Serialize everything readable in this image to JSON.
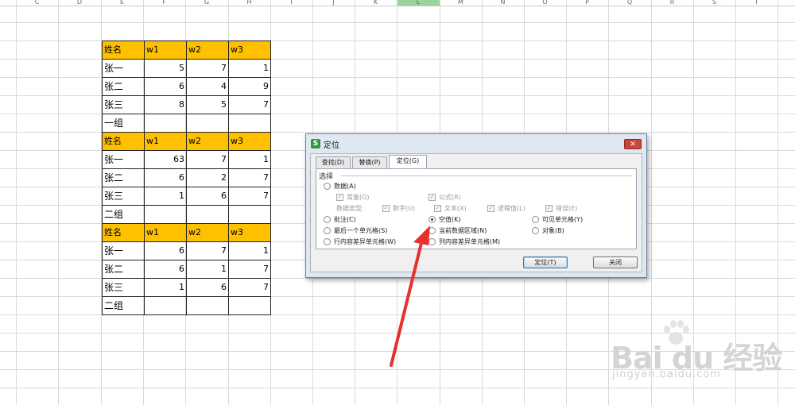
{
  "column_headers": [
    "C",
    "D",
    "E",
    "F",
    "G",
    "H",
    "I",
    "J",
    "K",
    "L",
    "M",
    "N",
    "O",
    "P",
    "Q",
    "R",
    "S",
    "T"
  ],
  "active_column": "L",
  "tables": [
    {
      "header": [
        "姓名",
        "w1",
        "w2",
        "w3"
      ],
      "rows": [
        [
          "张一",
          "5",
          "7",
          "1"
        ],
        [
          "张二",
          "6",
          "4",
          "9"
        ],
        [
          "张三",
          "8",
          "5",
          "7"
        ],
        [
          "一组",
          "",
          "",
          ""
        ]
      ]
    },
    {
      "header": [
        "姓名",
        "w1",
        "w2",
        "w3"
      ],
      "rows": [
        [
          "张一",
          "63",
          "7",
          "1"
        ],
        [
          "张二",
          "6",
          "2",
          "7"
        ],
        [
          "张三",
          "1",
          "6",
          "7"
        ],
        [
          "二组",
          "",
          "",
          ""
        ]
      ]
    },
    {
      "header": [
        "姓名",
        "w1",
        "w2",
        "w3"
      ],
      "rows": [
        [
          "张一",
          "6",
          "7",
          "1"
        ],
        [
          "张二",
          "6",
          "1",
          "7"
        ],
        [
          "张三",
          "1",
          "6",
          "7"
        ],
        [
          "二组",
          "",
          "",
          ""
        ]
      ]
    }
  ],
  "dialog": {
    "logo": "S",
    "title": "定位",
    "close": "✕",
    "tabs": [
      "查找(D)",
      "替换(P)",
      "定位(G)"
    ],
    "active_tab": "定位(G)",
    "group_label": "选择",
    "options": {
      "data": "数据(A)",
      "constant": "常量(O)",
      "formula": "公式(R)",
      "data_type": "数据类型:",
      "number": "数字(U)",
      "text": "文本(X)",
      "logical": "逻辑值(L)",
      "error": "错误(E)",
      "comment": "批注(C)",
      "blank": "空值(K)",
      "visible": "可见单元格(Y)",
      "last_cell": "最后一个单元格(S)",
      "current_region": "当前数据区域(N)",
      "object": "对象(B)",
      "row_diff": "行内容差异单元格(W)",
      "col_diff": "列内容差异单元格(M)"
    },
    "selected_option": "空值(K)",
    "buttons": {
      "locate": "定位(T)",
      "close": "关闭"
    }
  },
  "annotation": {
    "arrow_color": "#e8302f"
  },
  "watermark": {
    "logo": "Bai du 经验",
    "url": "jingyan.baidu.com"
  }
}
